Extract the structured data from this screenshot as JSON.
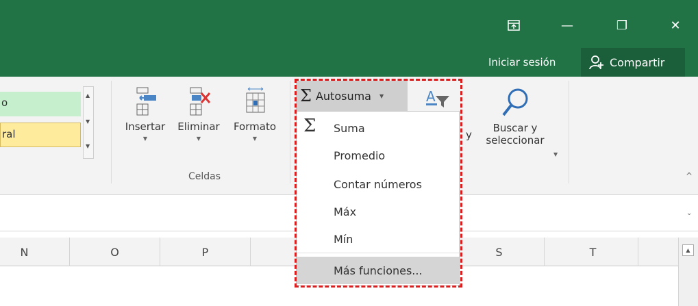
{
  "window": {
    "restore_ribbon_icon": "ribbon-display-icon",
    "minimize_glyph": "—",
    "maximize_glyph": "❐",
    "close_glyph": "✕"
  },
  "account": {
    "sign_in": "Iniciar sesión",
    "share": "Compartir"
  },
  "styles": {
    "cell1": "o",
    "cell2": "ral",
    "cell1_color": "#c6efce",
    "cell2_color": "#ffeb9c"
  },
  "celdas_group": {
    "label": "Celdas",
    "insert": "Insertar",
    "delete": "Eliminar",
    "format": "Formato"
  },
  "edit_group": {
    "autosum": "Autosuma",
    "find_select_line1": "Buscar y",
    "find_select_line2": "seleccionar",
    "partial_letter": "y"
  },
  "autosum_menu": {
    "items": [
      {
        "label": "Suma"
      },
      {
        "label": "Promedio"
      },
      {
        "label": "Contar números"
      },
      {
        "label": "Máx"
      },
      {
        "label": "Mín"
      },
      {
        "label": "Más funciones..."
      }
    ]
  },
  "columns": [
    "N",
    "O",
    "P",
    "",
    "",
    "S",
    "T"
  ],
  "colors": {
    "title_bar": "#217346",
    "highlight_outline": "#d81e1e"
  }
}
